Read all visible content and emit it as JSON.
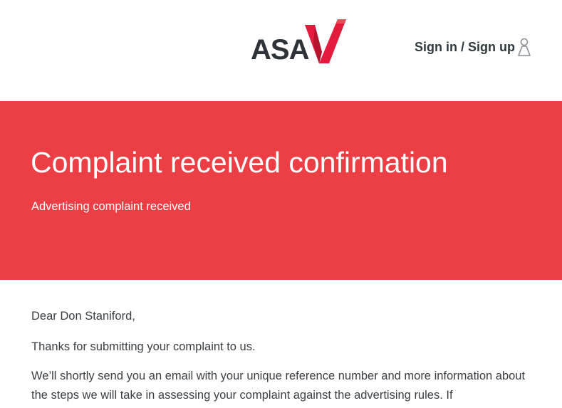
{
  "header": {
    "logo_text": "ASA",
    "logo_alt": "ASA logo",
    "signin_label": "Sign in / Sign up",
    "user_icon": "user-icon"
  },
  "banner": {
    "title": "Complaint received confirmation",
    "subtitle": "Advertising complaint received"
  },
  "content": {
    "greeting": "Dear Don Staniford,",
    "thanks": "Thanks for submitting your complaint to us.",
    "info": "We’ll shortly send you an email with your unique reference number and more information about the steps we will take in assessing your complaint against the advertising rules. If"
  },
  "colors": {
    "banner_background": "#ec3e45",
    "logo_text": "#2d3338",
    "logo_tick": "#e31c3d",
    "logo_tick_dark": "#a8132c",
    "body_text": "#3a3f44"
  }
}
